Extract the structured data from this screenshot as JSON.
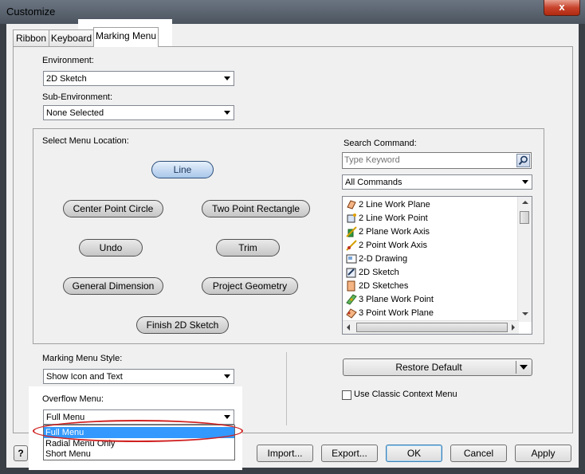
{
  "window": {
    "title": "Customize",
    "close_label": "x"
  },
  "tabs": [
    {
      "label": "Ribbon",
      "active": false
    },
    {
      "label": "Keyboard",
      "active": false
    },
    {
      "label": "Marking Menu",
      "active": true
    }
  ],
  "environment": {
    "label": "Environment:",
    "value": "2D Sketch"
  },
  "sub_environment": {
    "label": "Sub-Environment:",
    "value": "None Selected"
  },
  "menu_location": {
    "label": "Select Menu Location:",
    "items": [
      "Line",
      "Center Point Circle",
      "Two Point Rectangle",
      "Undo",
      "Trim",
      "General Dimension",
      "Project Geometry",
      "Finish 2D Sketch"
    ],
    "selected": "Line"
  },
  "search": {
    "label": "Search Command:",
    "placeholder": "Type Keyword",
    "filter_value": "All Commands"
  },
  "commands": [
    "2 Line Work Plane",
    "2 Line Work Point",
    "2 Plane Work Axis",
    "2 Point Work Axis",
    "2-D Drawing",
    "2D Sketch",
    "2D Sketches",
    "3 Plane Work Point",
    "3 Point Work Plane"
  ],
  "marking_menu_style": {
    "label": "Marking Menu Style:",
    "value": "Show Icon and Text"
  },
  "overflow_menu": {
    "label": "Overflow Menu:",
    "value": "Full Menu",
    "options": [
      "Full Menu",
      "Radial Menu Only",
      "Short Menu"
    ],
    "selected": "Full Menu"
  },
  "restore_default_label": "Restore Default",
  "classic_context_menu": {
    "label": "Use Classic Context Menu",
    "checked": false
  },
  "buttons": {
    "help": "?",
    "import": "Import...",
    "export": "Export...",
    "ok": "OK",
    "cancel": "Cancel",
    "apply": "Apply"
  },
  "colors": {
    "accent": "#3399ff",
    "annotation_circle": "#d02020"
  }
}
